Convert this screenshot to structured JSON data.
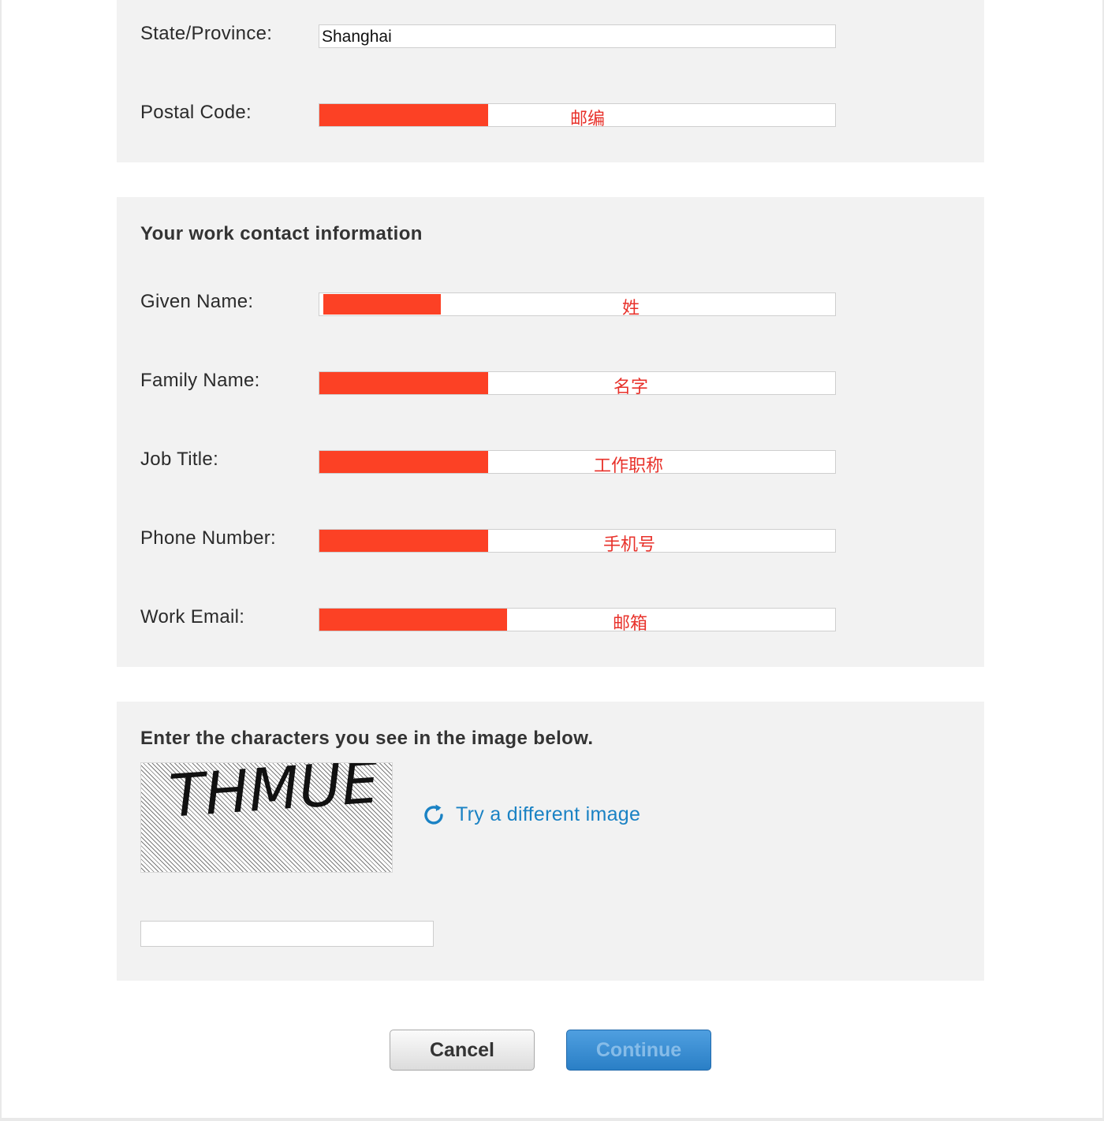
{
  "address": {
    "state_label": "State/Province:",
    "state_value": "Shanghai",
    "postal_label": "Postal Code:",
    "postal_hint": "邮编"
  },
  "work_contact": {
    "heading": "Your work contact information",
    "given_name_label": "Given Name:",
    "given_name_hint": "姓",
    "family_name_label": "Family Name:",
    "family_name_hint": "名字",
    "job_title_label": "Job Title:",
    "job_title_hint": "工作职称",
    "phone_label": "Phone Number:",
    "phone_hint": "手机号",
    "email_label": "Work Email:",
    "email_hint": "邮箱"
  },
  "captcha": {
    "instruction": "Enter the characters you see in the image below.",
    "image_text": "THMUE",
    "refresh_link": "Try a different image",
    "answer_value": ""
  },
  "buttons": {
    "cancel": "Cancel",
    "continue": "Continue"
  },
  "colors": {
    "redaction": "#fc4125",
    "hint_text": "#e8322b",
    "link": "#1a82c4",
    "primary_button": "#2a7fc6"
  },
  "icons": {
    "refresh": "refresh-icon"
  }
}
